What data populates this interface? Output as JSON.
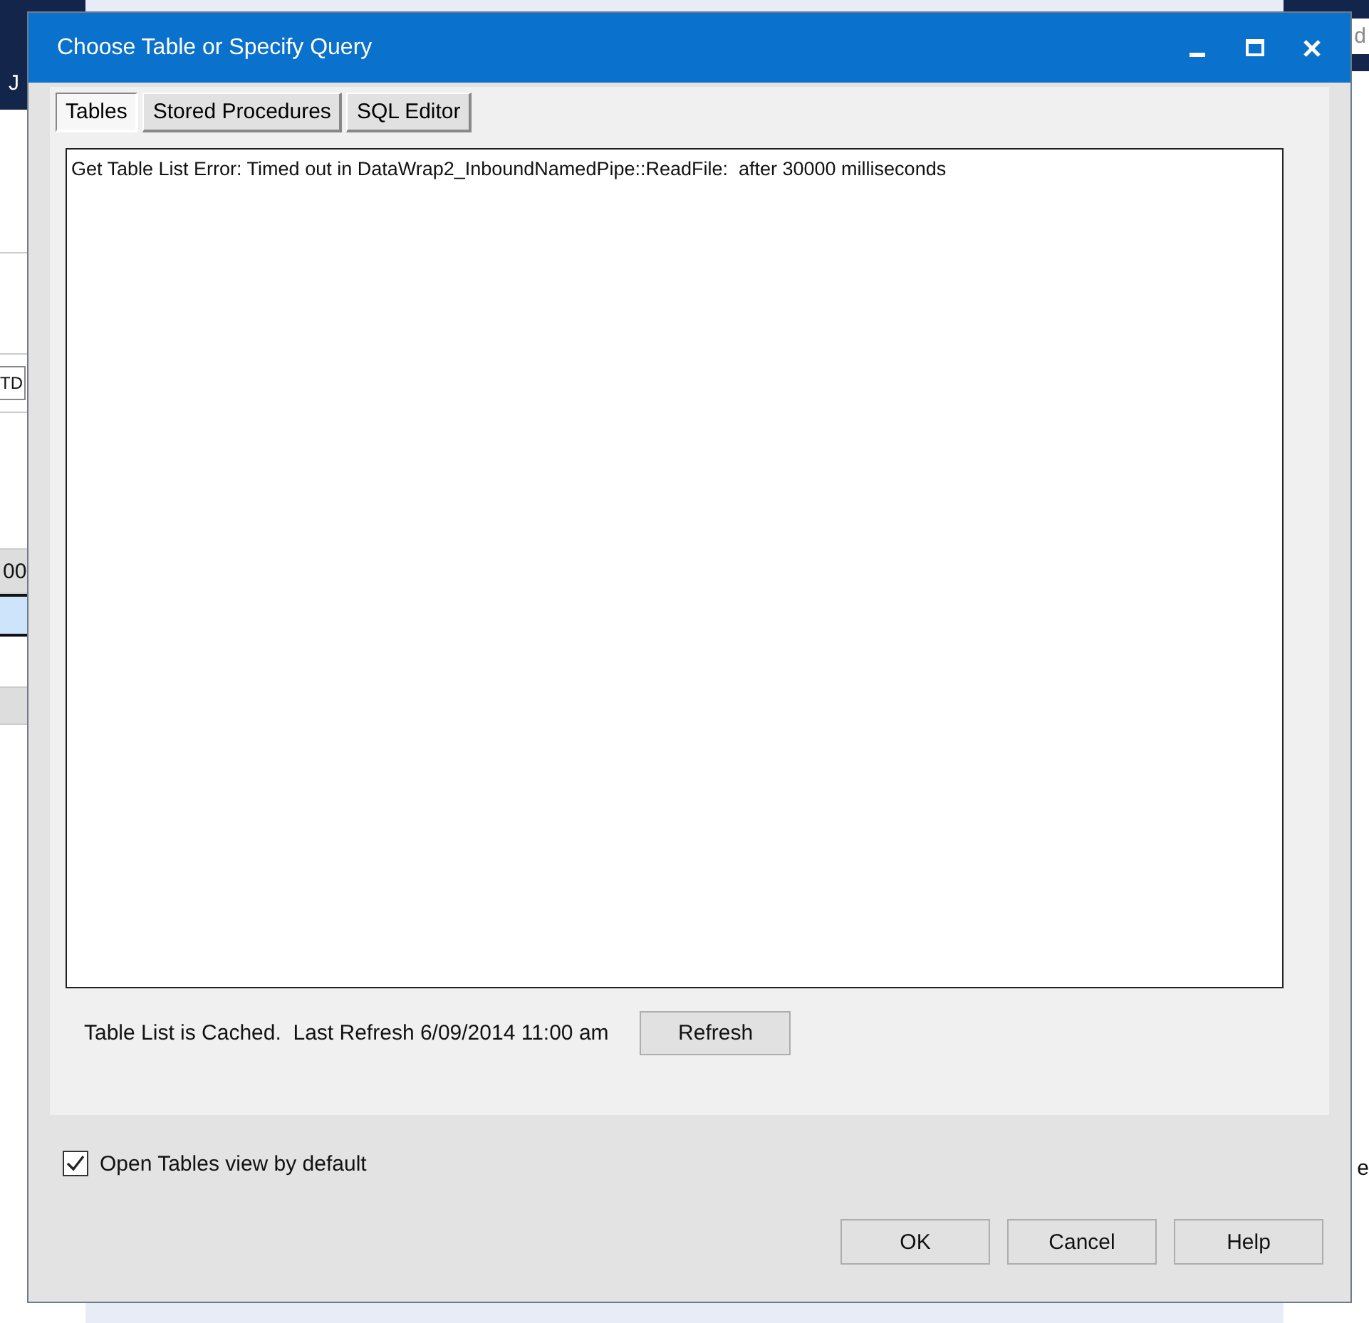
{
  "background": {
    "fragments": [
      {
        "kind": "header",
        "text": "J"
      },
      {
        "kind": "field",
        "text": "TD"
      },
      {
        "kind": "row",
        "text": "00"
      },
      {
        "kind": "search",
        "text": "d"
      },
      {
        "kind": "label",
        "text": "e"
      }
    ]
  },
  "dialog": {
    "title": "Choose Table or Specify Query",
    "tabs": [
      {
        "label": "Tables",
        "selected": true
      },
      {
        "label": "Stored Procedures",
        "selected": false
      },
      {
        "label": "SQL Editor",
        "selected": false
      }
    ],
    "list_text": "Get Table List Error: Timed out in DataWrap2_InboundNamedPipe::ReadFile:  after 30000 milliseconds",
    "cache_status": "Table List is Cached.  Last Refresh 6/09/2014 11:00 am",
    "refresh_button": "Refresh",
    "default_view_checkbox": {
      "label": "Open Tables view by default",
      "checked": true
    },
    "buttons": [
      "OK",
      "Cancel",
      "Help"
    ]
  }
}
